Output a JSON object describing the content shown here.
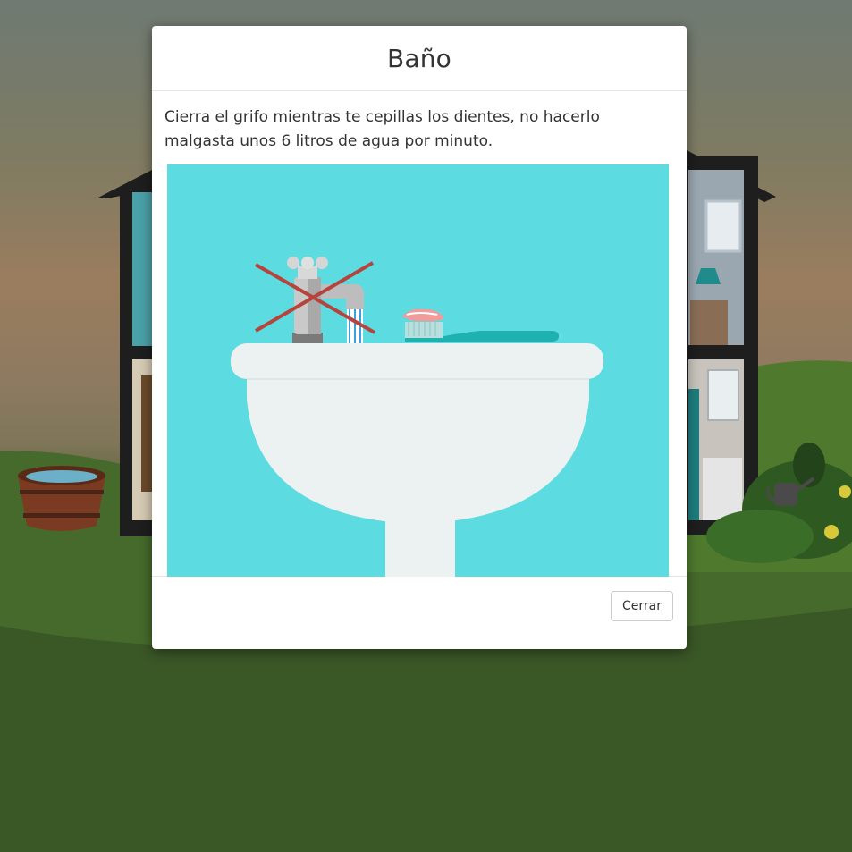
{
  "modal": {
    "title": "Baño",
    "message": "Cierra el grifo mientras te cepillas los dientes, no hacerlo malgasta unos 6 litros de agua por minuto.",
    "close_label": "Cerrar"
  },
  "colors": {
    "illustration_bg": "#5cdbe0",
    "sink": "#ecf1f1",
    "cross": "#b5443d",
    "toothbrush": "#1fb0b0",
    "toothpaste": "#f29b9b",
    "grass": "#3f5e2b",
    "house_frame": "#1e1e1e"
  },
  "icons": {
    "background_scene": "house-scene",
    "illustration": "sink-faucet-toothbrush-illustration"
  }
}
